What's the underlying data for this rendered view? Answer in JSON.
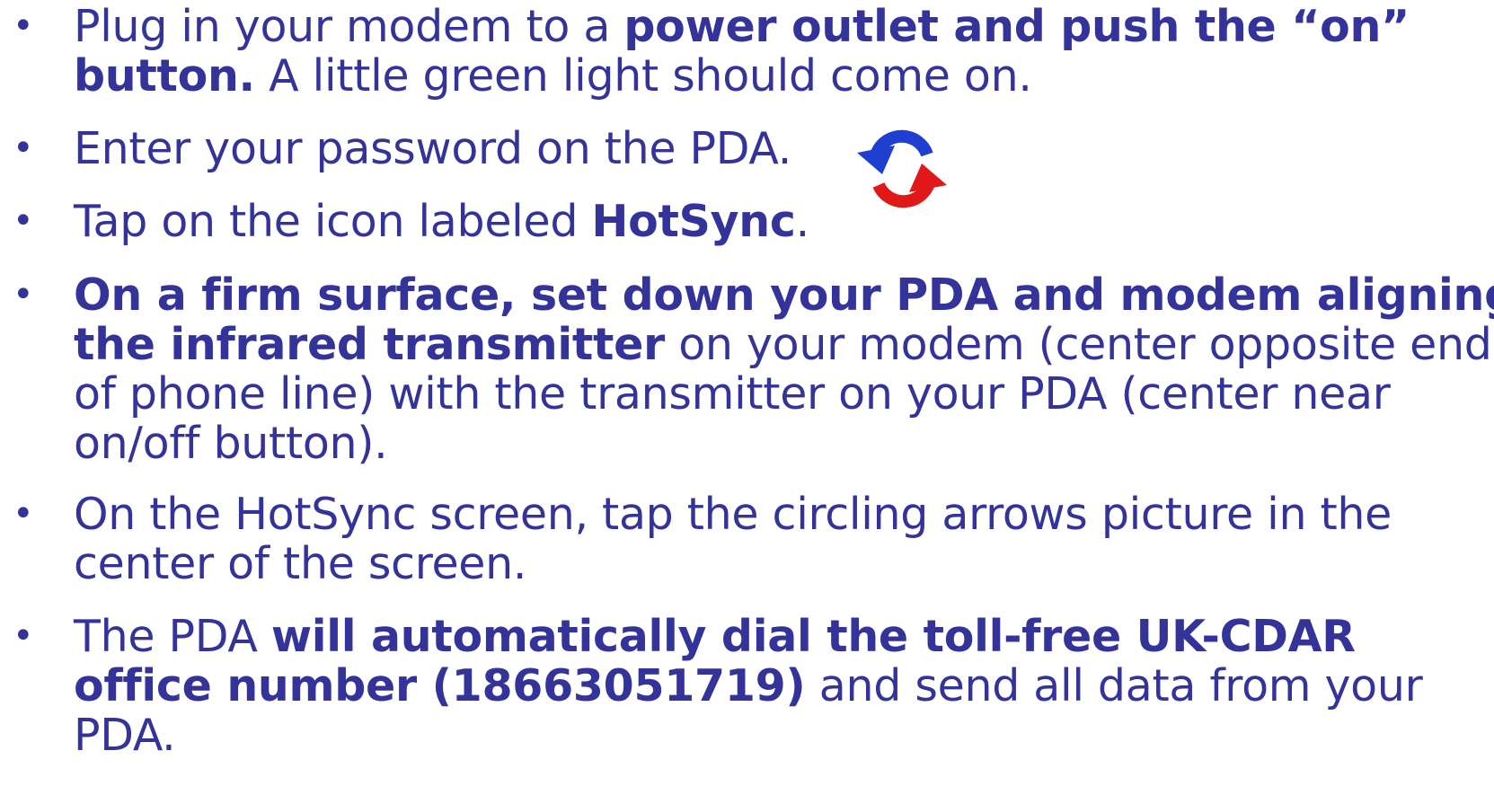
{
  "items": [
    {
      "lines": [
        [
          {
            "t": "Plug in your modem to a "
          },
          {
            "t": "power outlet and push the “on”",
            "b": true
          }
        ],
        [
          {
            "t": "button.",
            "b": true
          },
          {
            "t": "  A little green light should come on."
          }
        ]
      ]
    },
    {
      "lines": [
        [
          {
            "t": "Enter your password on the PDA."
          }
        ]
      ]
    },
    {
      "lines": [
        [
          {
            "t": "Tap on the icon labeled "
          },
          {
            "t": "HotSync",
            "b": true
          },
          {
            "t": "."
          }
        ]
      ]
    },
    {
      "lines": [
        [
          {
            "t": "On a firm surface, set down your PDA and modem aligning",
            "b": true
          }
        ],
        [
          {
            "t": "the infrared transmitter",
            "b": true
          },
          {
            "t": " on your modem (center opposite end"
          }
        ],
        [
          {
            "t": "of phone line) with the transmitter on your PDA (center near"
          }
        ],
        [
          {
            "t": "on/off button)."
          }
        ]
      ]
    },
    {
      "lines": [
        [
          {
            "t": "On the HotSync screen, tap the circling arrows picture in the"
          }
        ],
        [
          {
            "t": "center of the screen."
          }
        ]
      ]
    },
    {
      "lines": [
        [
          {
            "t": "The PDA "
          },
          {
            "t": "will automatically dial the toll-free UK-CDAR",
            "b": true
          }
        ],
        [
          {
            "t": "office number (18663051719)",
            "b": true
          },
          {
            "t": " and send all data from your"
          }
        ],
        [
          {
            "t": "PDA."
          }
        ]
      ]
    }
  ],
  "bullet_char": "•",
  "icon": {
    "name": "hotsync-icon",
    "colors": {
      "blue": "#1f3fd0",
      "red": "#e01818"
    }
  },
  "colors": {
    "text": "#333399",
    "background": "#ffffff"
  }
}
